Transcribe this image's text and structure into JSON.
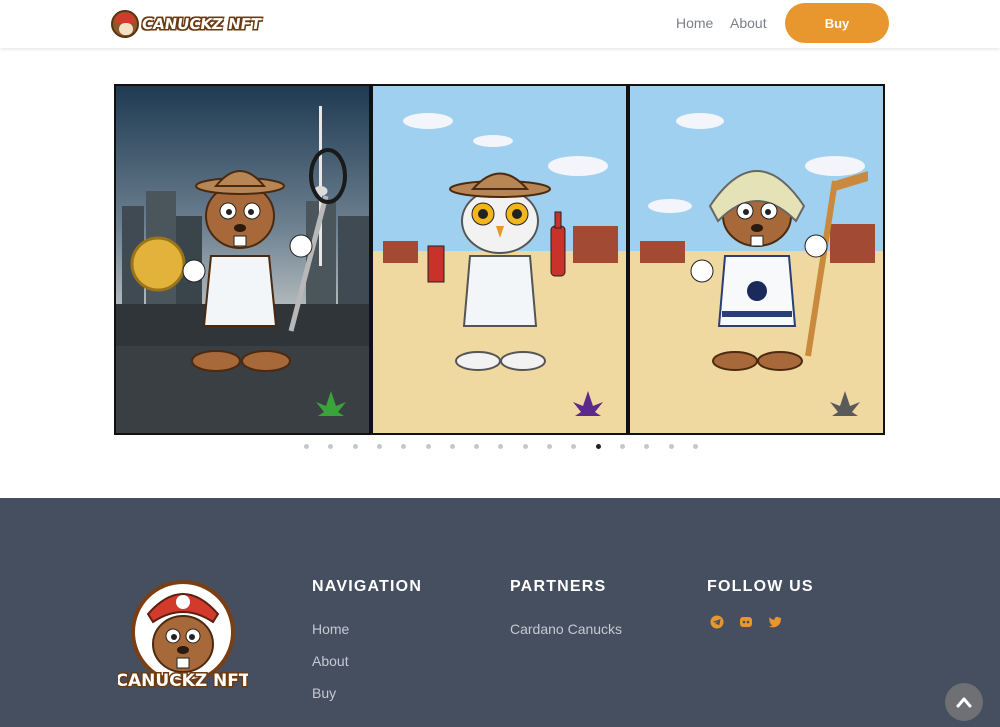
{
  "header": {
    "logo_text": "CANUCKZ NFT",
    "nav": [
      {
        "label": "Home"
      },
      {
        "label": "About"
      }
    ],
    "buy_label": "Buy"
  },
  "carousel": {
    "slides": [
      {
        "character": "beaver",
        "hat": "ranger-hat",
        "item": "lacrosse-stick",
        "leaf_color": "#3aa33a"
      },
      {
        "character": "snowy-owl",
        "hat": "ranger-hat",
        "item": "drinks",
        "leaf_color": "#5b2a8a"
      },
      {
        "character": "beaver",
        "hat": "trapper-hat",
        "item": "hockey-stick",
        "leaf_color": "#5a5a5a"
      }
    ],
    "dots_total": 17,
    "active_dot": 13
  },
  "footer": {
    "logo_text": "CANUCKZ NFT",
    "navigation": {
      "title": "NAVIGATION",
      "links": [
        "Home",
        "About",
        "Buy"
      ]
    },
    "partners": {
      "title": "PARTNERS",
      "links": [
        "Cardano Canucks"
      ]
    },
    "follow": {
      "title": "FOLLOW US",
      "icons": [
        "telegram-icon",
        "discord-icon",
        "twitter-icon"
      ]
    }
  },
  "colors": {
    "accent": "#e8962e",
    "footer_bg": "#464f60"
  }
}
